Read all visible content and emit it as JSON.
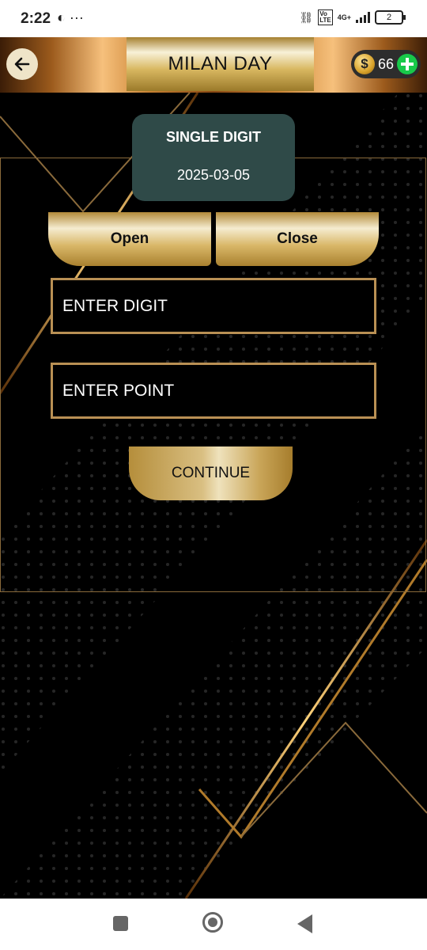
{
  "status_bar": {
    "time": "2:22",
    "left_icons": "◐ ···",
    "network_type": "4G+",
    "battery_level": "2"
  },
  "header": {
    "title": "MILAN DAY",
    "wallet_balance": "66",
    "coin_symbol": "$"
  },
  "game": {
    "type": "SINGLE DIGIT",
    "date": "2025-03-05"
  },
  "session": {
    "open_label": "Open",
    "close_label": "Close"
  },
  "form": {
    "digit_placeholder": "ENTER DIGIT",
    "point_placeholder": "ENTER POINT",
    "continue_label": "CONTINUE"
  },
  "colors": {
    "accent_gold": "#d9b768",
    "card_teal": "#2f4a48",
    "field_border": "#b99054",
    "add_green": "#18c94a"
  }
}
